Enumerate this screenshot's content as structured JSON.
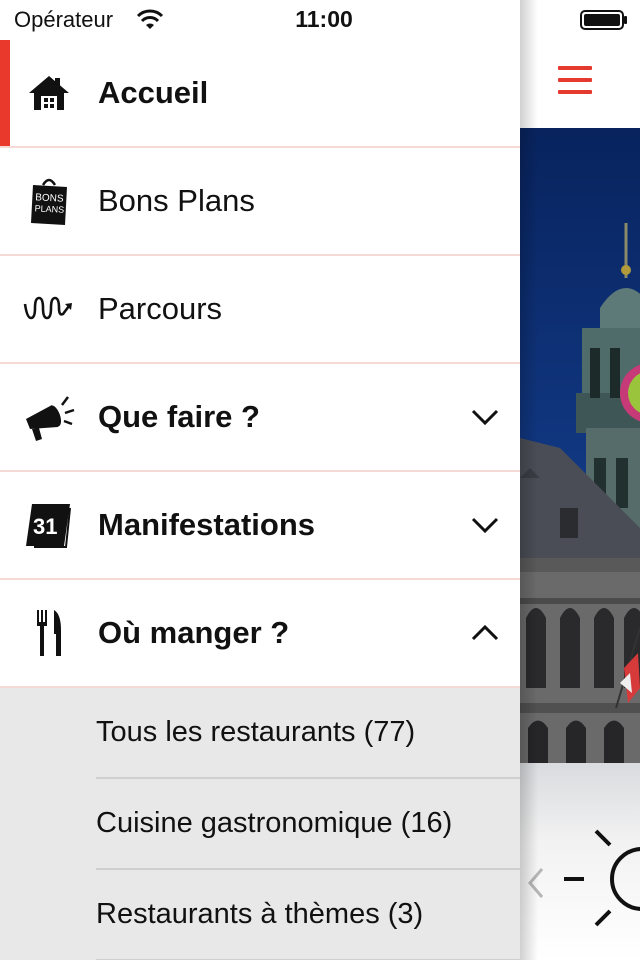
{
  "status_bar": {
    "carrier": "Opérateur",
    "time": "11:00"
  },
  "menu": {
    "items": [
      {
        "label": "Accueil",
        "icon": "home-icon",
        "active": true
      },
      {
        "label": "Bons Plans",
        "icon": "bons-plans-bag-icon",
        "icon_text": "BONS PLANS"
      },
      {
        "label": "Parcours",
        "icon": "route-path-icon"
      },
      {
        "label": "Que faire ?",
        "icon": "megaphone-icon",
        "expandable": true,
        "expanded": false
      },
      {
        "label": "Manifestations",
        "icon": "calendar-icon",
        "icon_text": "31",
        "expandable": true,
        "expanded": false
      },
      {
        "label": "Où manger ?",
        "icon": "cutlery-icon",
        "expandable": true,
        "expanded": true
      }
    ],
    "sub_items": [
      {
        "label": "Tous les restaurants (77)"
      },
      {
        "label": "Cuisine gastronomique (16)"
      },
      {
        "label": "Restaurants à thèmes (3)"
      }
    ]
  },
  "background_app": {
    "menu_icon": "hamburger-menu-icon",
    "hero_subject": "town hall belfry photo",
    "weather_icon": "sun-icon",
    "nav_icon": "chevron-left-icon"
  },
  "colors": {
    "accent": "#e8392c",
    "divider": "#f6d9d5",
    "submenu_bg": "#e8e8e8"
  }
}
